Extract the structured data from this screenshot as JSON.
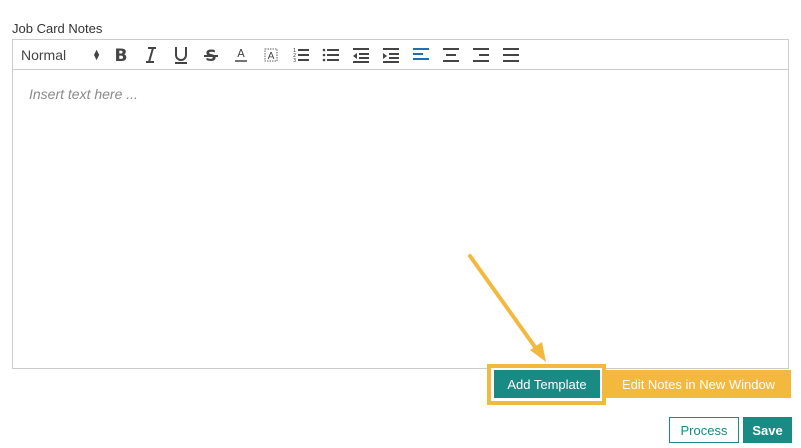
{
  "field": {
    "label": "Job Card Notes",
    "placeholder": "Insert text here ..."
  },
  "toolbar": {
    "format_value": "Normal",
    "buttons": [
      {
        "name": "bold-icon"
      },
      {
        "name": "italic-icon"
      },
      {
        "name": "underline-icon"
      },
      {
        "name": "strikethrough-icon"
      },
      {
        "name": "text-color-icon"
      },
      {
        "name": "background-color-icon"
      },
      {
        "name": "ordered-list-icon"
      },
      {
        "name": "bullet-list-icon"
      },
      {
        "name": "outdent-icon"
      },
      {
        "name": "indent-icon"
      },
      {
        "name": "align-left-icon"
      },
      {
        "name": "align-center-icon"
      },
      {
        "name": "align-right-icon"
      },
      {
        "name": "align-justify-icon"
      }
    ]
  },
  "actions": {
    "add_template": "Add Template",
    "edit_notes_window": "Edit Notes in New Window",
    "process": "Process",
    "save": "Save"
  },
  "colors": {
    "primary": "#1a8a84",
    "highlight": "#f3b93f",
    "active_align": "#1f6fb5"
  }
}
